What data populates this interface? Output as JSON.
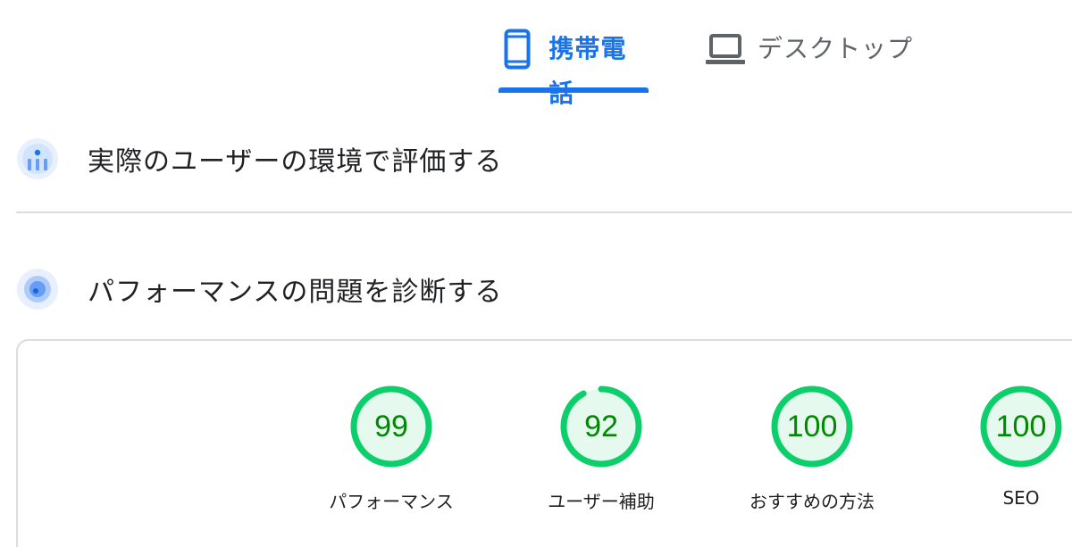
{
  "tabs": {
    "mobile_label": "携帯電話",
    "desktop_label": "デスクトップ",
    "active": "mobile",
    "accent_color": "#1a73e8"
  },
  "sections": {
    "field_data_title": "実際のユーザーの環境で評価する",
    "diagnose_title": "パフォーマンスの問題を診断する"
  },
  "scores": [
    {
      "label": "パフォーマンス",
      "value": "99",
      "fraction": 0.99
    },
    {
      "label": "ユーザー補助",
      "value": "92",
      "fraction": 0.92
    },
    {
      "label": "おすすめの方法",
      "value": "100",
      "fraction": 1.0
    },
    {
      "label": "SEO",
      "value": "100",
      "fraction": 1.0
    }
  ],
  "colors": {
    "pass_stroke": "#0cce6b",
    "pass_fill": "#e6f9ee",
    "pass_text": "#008800"
  },
  "icons": {
    "mobile_tab": "smartphone-icon",
    "desktop_tab": "laptop-icon",
    "field_data": "field-data-chart-icon",
    "diagnose": "lab-data-compass-icon"
  }
}
